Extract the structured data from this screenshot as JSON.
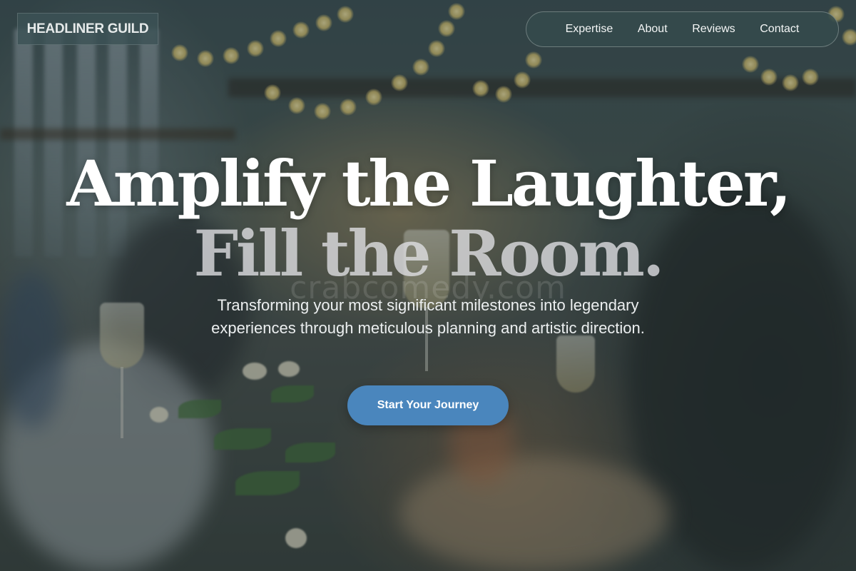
{
  "brand": {
    "name": "HEADLINER GUILD"
  },
  "nav": {
    "items": [
      {
        "label": "Expertise"
      },
      {
        "label": "About"
      },
      {
        "label": "Reviews"
      },
      {
        "label": "Contact"
      }
    ]
  },
  "hero": {
    "title_line_1": "Amplify the Laughter,",
    "title_line_2": "Fill the Room.",
    "watermark": "crabcomedy.com",
    "subtitle": "Transforming your most significant milestones into legendary experiences through meticulous planning and artistic direction.",
    "cta_label": "Start Your Journey"
  },
  "colors": {
    "accent": "#4a86bd",
    "nav_background": "#344a4c",
    "logo_background": "#3c5255"
  }
}
